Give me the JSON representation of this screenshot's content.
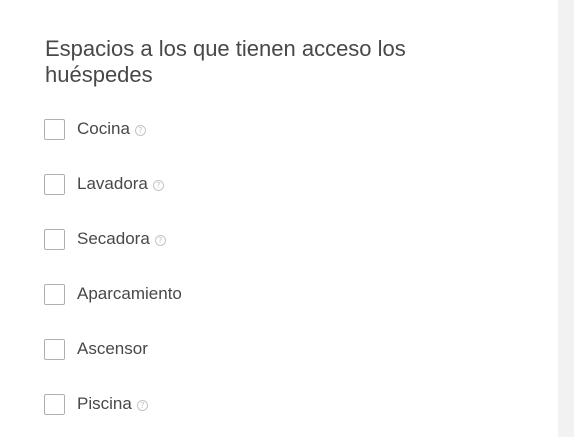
{
  "section": {
    "title": "Espacios a los que tienen acceso los huéspedes"
  },
  "amenities": [
    {
      "label": "Cocina",
      "checked": false,
      "has_help": true
    },
    {
      "label": "Lavadora",
      "checked": false,
      "has_help": true
    },
    {
      "label": "Secadora",
      "checked": false,
      "has_help": true
    },
    {
      "label": "Aparcamiento",
      "checked": false,
      "has_help": false
    },
    {
      "label": "Ascensor",
      "checked": false,
      "has_help": false
    },
    {
      "label": "Piscina",
      "checked": false,
      "has_help": true
    }
  ],
  "icons": {
    "help_glyph": "?",
    "help_icon_name": "help-circle-icon"
  },
  "colors": {
    "text": "#484848",
    "checkbox_border": "#b0b0b0",
    "help_icon": "#c4c4c4",
    "gutter": "#f2f2f2"
  }
}
